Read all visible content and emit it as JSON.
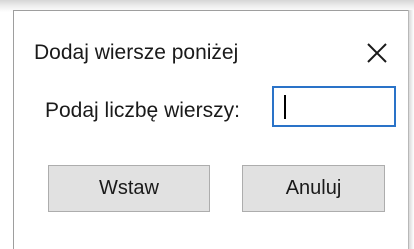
{
  "dialog": {
    "title": "Dodaj wiersze poniżej",
    "close_icon": "close-icon"
  },
  "form": {
    "rows_label": "Podaj liczbę wierszy:",
    "rows_value": ""
  },
  "buttons": {
    "insert_label": "Wstaw",
    "cancel_label": "Anuluj"
  },
  "colors": {
    "input_focus_border": "#2a73c8",
    "button_bg": "#e1e1e1",
    "button_border": "#adadad"
  }
}
